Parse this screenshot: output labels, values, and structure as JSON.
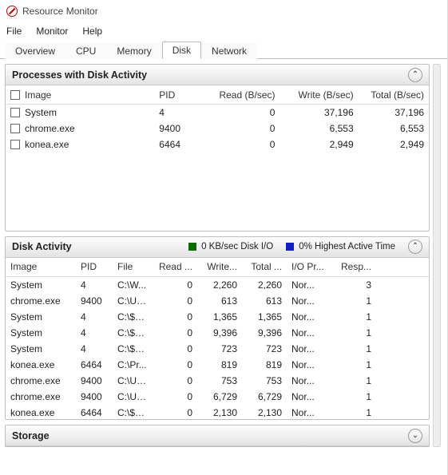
{
  "window": {
    "title": "Resource Monitor"
  },
  "menu": {
    "file": "File",
    "monitor": "Monitor",
    "help": "Help"
  },
  "tabs": {
    "overview": "Overview",
    "cpu": "CPU",
    "memory": "Memory",
    "disk": "Disk",
    "network": "Network"
  },
  "panel1": {
    "title": "Processes with Disk Activity",
    "headers": {
      "image": "Image",
      "pid": "PID",
      "read": "Read (B/sec)",
      "write": "Write (B/sec)",
      "total": "Total (B/sec)"
    },
    "rows": [
      {
        "image": "System",
        "pid": "4",
        "read": "0",
        "write": "37,196",
        "total": "37,196"
      },
      {
        "image": "chrome.exe",
        "pid": "9400",
        "read": "0",
        "write": "6,553",
        "total": "6,553"
      },
      {
        "image": "konea.exe",
        "pid": "6464",
        "read": "0",
        "write": "2,949",
        "total": "2,949"
      }
    ]
  },
  "panel2": {
    "title": "Disk Activity",
    "stat1": "0 KB/sec Disk I/O",
    "stat2": "0% Highest Active Time",
    "headers": {
      "image": "Image",
      "pid": "PID",
      "file": "File",
      "read": "Read ...",
      "write": "Write...",
      "total": "Total ...",
      "io": "I/O Pr...",
      "resp": "Resp..."
    },
    "rows": [
      {
        "image": "System",
        "pid": "4",
        "file": "C:\\W...",
        "read": "0",
        "write": "2,260",
        "total": "2,260",
        "io": "Nor...",
        "resp": "3"
      },
      {
        "image": "chrome.exe",
        "pid": "9400",
        "file": "C:\\Us...",
        "read": "0",
        "write": "613",
        "total": "613",
        "io": "Nor...",
        "resp": "1"
      },
      {
        "image": "System",
        "pid": "4",
        "file": "C:\\$L...",
        "read": "0",
        "write": "1,365",
        "total": "1,365",
        "io": "Nor...",
        "resp": "1"
      },
      {
        "image": "System",
        "pid": "4",
        "file": "C:\\$L...",
        "read": "0",
        "write": "9,396",
        "total": "9,396",
        "io": "Nor...",
        "resp": "1"
      },
      {
        "image": "System",
        "pid": "4",
        "file": "C:\\$L...",
        "read": "0",
        "write": "723",
        "total": "723",
        "io": "Nor...",
        "resp": "1"
      },
      {
        "image": "konea.exe",
        "pid": "6464",
        "file": "C:\\Pr...",
        "read": "0",
        "write": "819",
        "total": "819",
        "io": "Nor...",
        "resp": "1"
      },
      {
        "image": "chrome.exe",
        "pid": "9400",
        "file": "C:\\Us...",
        "read": "0",
        "write": "753",
        "total": "753",
        "io": "Nor...",
        "resp": "1"
      },
      {
        "image": "chrome.exe",
        "pid": "9400",
        "file": "C:\\Us...",
        "read": "0",
        "write": "6,729",
        "total": "6,729",
        "io": "Nor...",
        "resp": "1"
      },
      {
        "image": "konea.exe",
        "pid": "6464",
        "file": "C:\\$L...",
        "read": "0",
        "write": "2,130",
        "total": "2,130",
        "io": "Nor...",
        "resp": "1"
      }
    ]
  },
  "panel3": {
    "title": "Storage"
  }
}
